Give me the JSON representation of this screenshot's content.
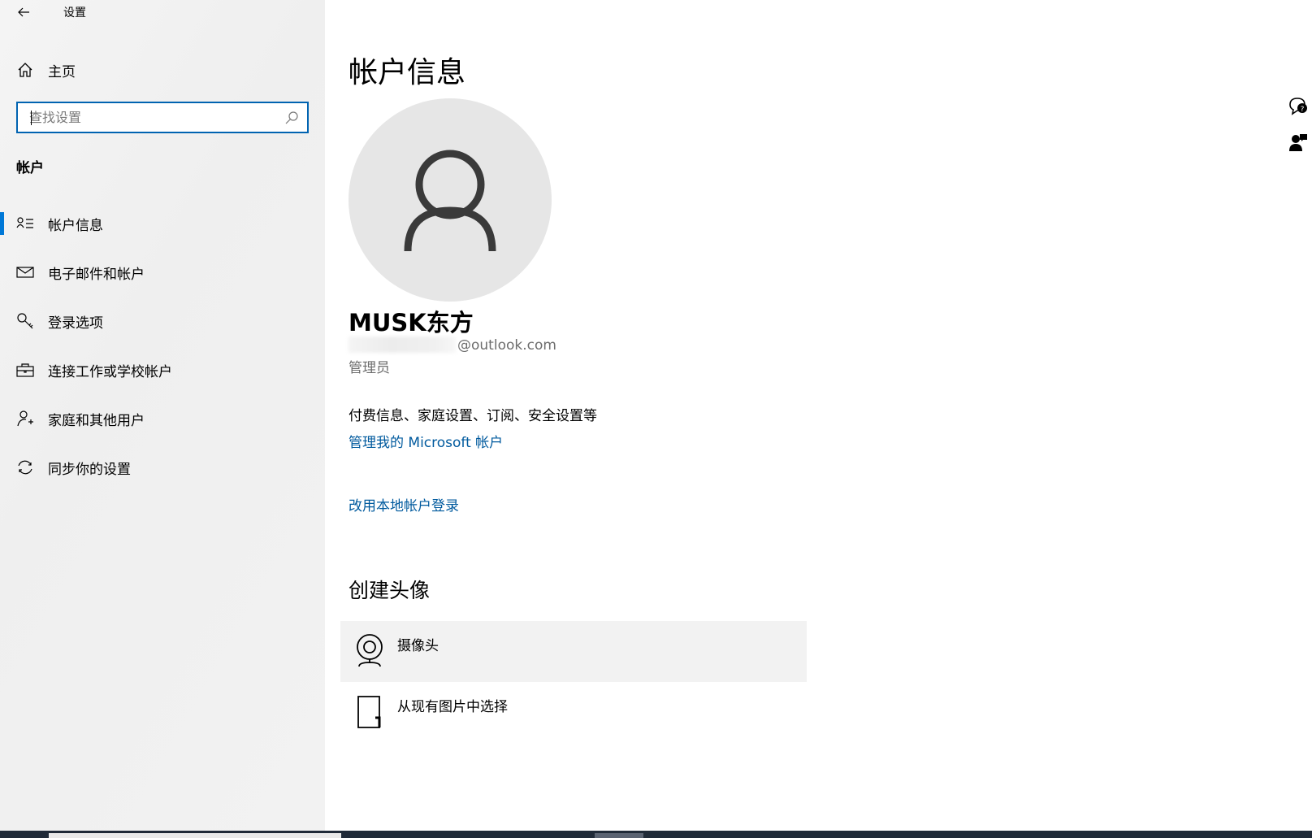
{
  "window": {
    "title": "设置"
  },
  "sidebar": {
    "home_label": "主页",
    "search_placeholder": "查找设置",
    "section_title": "帐户",
    "items": [
      {
        "label": "帐户信息",
        "icon": "account-info-icon",
        "active": true
      },
      {
        "label": "电子邮件和帐户",
        "icon": "mail-icon",
        "active": false
      },
      {
        "label": "登录选项",
        "icon": "key-icon",
        "active": false
      },
      {
        "label": "连接工作或学校帐户",
        "icon": "briefcase-icon",
        "active": false
      },
      {
        "label": "家庭和其他用户",
        "icon": "add-user-icon",
        "active": false
      },
      {
        "label": "同步你的设置",
        "icon": "sync-icon",
        "active": false
      }
    ]
  },
  "main": {
    "title": "帐户信息",
    "user": {
      "name": "MUSK东方",
      "email_visible_suffix": "@outlook.com",
      "role": "管理员"
    },
    "info_text": "付费信息、家庭设置、订阅、安全设置等",
    "manage_link": "管理我的 Microsoft 帐户",
    "local_account_link": "改用本地帐户登录",
    "create_avatar": {
      "heading": "创建头像",
      "options": [
        {
          "label": "摄像头",
          "icon": "webcam-icon"
        },
        {
          "label": "从现有图片中选择",
          "icon": "browse-file-icon"
        }
      ]
    }
  },
  "colors": {
    "accent": "#0078d7",
    "link": "#005a9e",
    "search_border": "#0063b1",
    "sidebar_bg": "#f2f2f2",
    "avatar_bg": "#e6e6e6"
  }
}
